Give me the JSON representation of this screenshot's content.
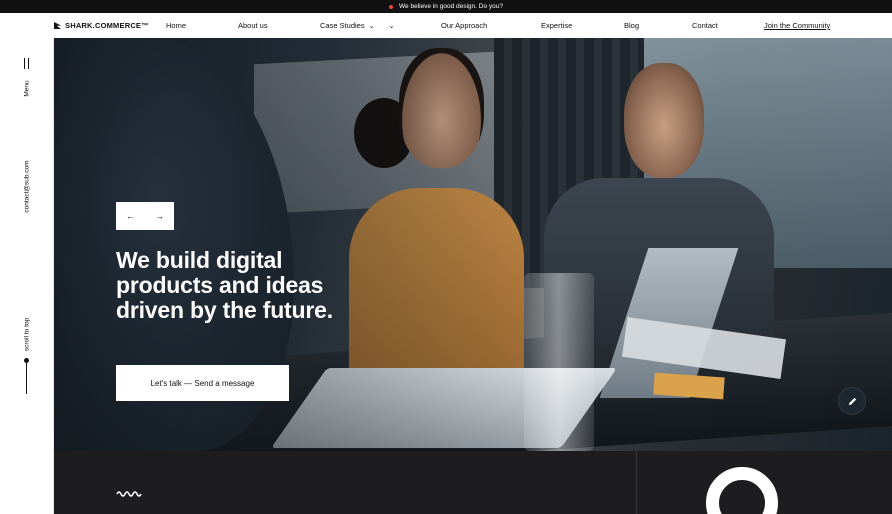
{
  "announcement": {
    "text": "We believe in good design. Do you?",
    "dot_color": "#e8443a"
  },
  "nav": {
    "logo": "SHARK.COMMERCE™",
    "items": [
      {
        "label": "Home"
      },
      {
        "label": "About us"
      },
      {
        "label": "Case Studies"
      },
      {
        "label": "Our Approach"
      },
      {
        "label": "Expertise"
      },
      {
        "label": "Blog"
      },
      {
        "label": "Contact"
      }
    ],
    "community": "Join the Community"
  },
  "sidebar": {
    "menu_label": "Menu",
    "email": "contact@sub.com",
    "scroll_label": "scroll to top"
  },
  "hero": {
    "prev_arrow": "←",
    "next_arrow": "→",
    "headline": "We build digital products and ideas driven by the future.",
    "cta_label": "Let's talk — Send a message",
    "edit_icon": "pencil-icon"
  },
  "colors": {
    "dark": "#1d1d1f",
    "accent": "#e8443a"
  }
}
